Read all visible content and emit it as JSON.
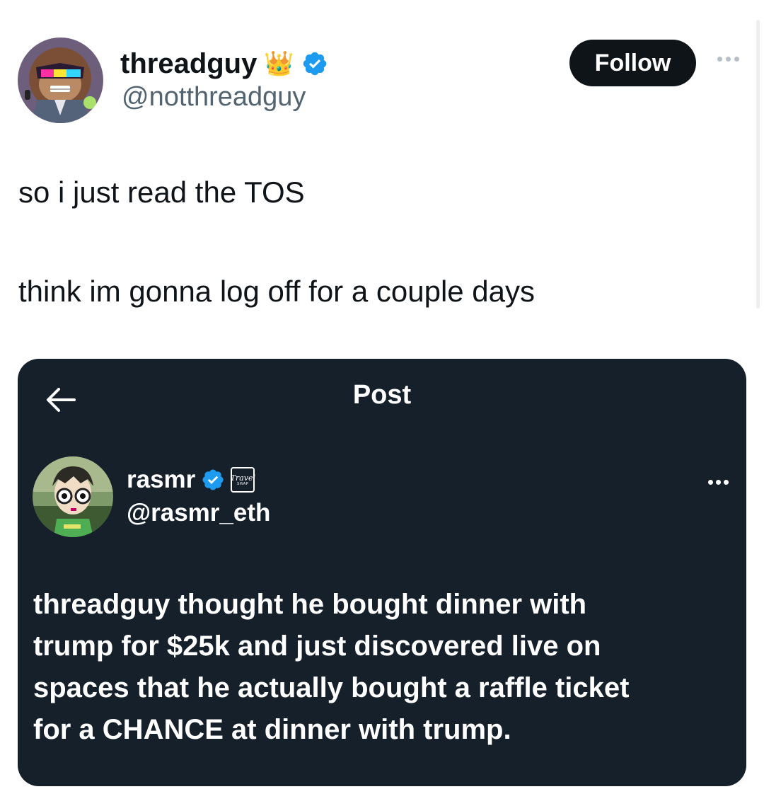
{
  "tweet": {
    "author": {
      "display_name": "threadguy",
      "name_emoji": "👑",
      "handle": "@notthreadguy",
      "verified": true,
      "avatar_icon": "monkey-with-sunglasses-avatar"
    },
    "follow_label": "Follow",
    "more_icon": "more-horizontal-icon",
    "text_lines": [
      "so i just read the TOS",
      "think im gonna log off for a couple days"
    ]
  },
  "embedded_post": {
    "header_title": "Post",
    "back_icon": "back-arrow-icon",
    "author": {
      "display_name": "rasmr",
      "handle": "@rasmr_eth",
      "verified": true,
      "affiliate_badge": {
        "line1": "Travel",
        "line2": "SWAP"
      },
      "avatar_icon": "pixel-character-avatar"
    },
    "text_lines": [
      "threadguy thought he bought dinner with",
      "trump for $25k and just discovered live on",
      "spaces that he actually bought a raffle ticket",
      "for a CHANCE at dinner with trump."
    ]
  },
  "colors": {
    "verified_blue": "#1d9bf0",
    "card_background": "#15202b",
    "follow_button": "#0f1419",
    "secondary_text": "#536471"
  }
}
